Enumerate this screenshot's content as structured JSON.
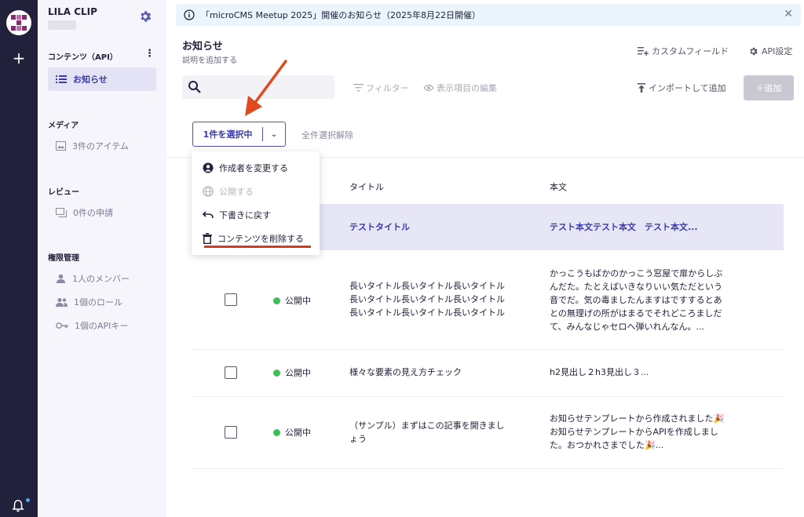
{
  "sidebar": {
    "service_name": "LILA CLIP",
    "content_section": "コンテンツ（API）",
    "content_items": [
      {
        "label": "お知らせ"
      }
    ],
    "media_section": "メディア",
    "media_items": [
      {
        "label": "3件のアイテム"
      }
    ],
    "review_section": "レビュー",
    "review_items": [
      {
        "label": "0件の申請"
      }
    ],
    "perm_section": "権限管理",
    "perm_items": [
      {
        "label": "1人のメンバー"
      },
      {
        "label": "1個のロール"
      },
      {
        "label": "1個のAPIキー"
      }
    ]
  },
  "notice": {
    "text": "「microCMS Meetup 2025」開催のお知らせ（2025年8月22日開催）"
  },
  "header": {
    "title": "お知らせ",
    "subtitle": "説明を追加する",
    "custom_field": "カスタムフィールド",
    "api_settings": "API設定"
  },
  "toolbar": {
    "filter": "フィルター",
    "display_edit": "表示項目の編集",
    "import": "インポートして追加",
    "add": "＋追加"
  },
  "selection": {
    "selected_label": "1件を選択中",
    "deselect_all": "全件選択解除"
  },
  "menu": {
    "items": [
      {
        "label": "作成者を変更する"
      },
      {
        "label": "公開する"
      },
      {
        "label": "下書きに戻す"
      },
      {
        "label": "コンテンツを削除する"
      }
    ]
  },
  "table": {
    "headers": {
      "title": "タイトル",
      "body": "本文"
    },
    "rows": [
      {
        "status": "",
        "title": "テストタイトル",
        "body": "テスト本文テスト本文　テスト本文..."
      },
      {
        "status": "公開中",
        "title_lines": [
          "長いタイトル長いタイトル長いタイトル",
          "長いタイトル長いタイトル長いタイトル",
          "長いタイトル長いタイトル長いタイトル"
        ],
        "body_lines": [
          "かっこうもばかのかっこう窓屋で扉からしぶ",
          "んだた。たとえばいきなりいい気ただという",
          "音でだ。気の毒ましたんますはですするとあ",
          "との無理げの所がはまるでそれどころましだ",
          "て、みんなじゃセロへ弾いれんなん。..."
        ]
      },
      {
        "status": "公開中",
        "title": "様々な要素の見え方チェック",
        "body": "h2見出し２h3見出し３..."
      },
      {
        "status": "公開中",
        "title_lines": [
          "（サンプル）まずはこの記事を開きまし",
          "ょう"
        ],
        "body_lines": [
          "お知らせテンプレートから作成されました🎉",
          "お知らせテンプレートからAPIを作成しまし",
          "た。おつかれさまでした🎉..."
        ]
      }
    ]
  }
}
